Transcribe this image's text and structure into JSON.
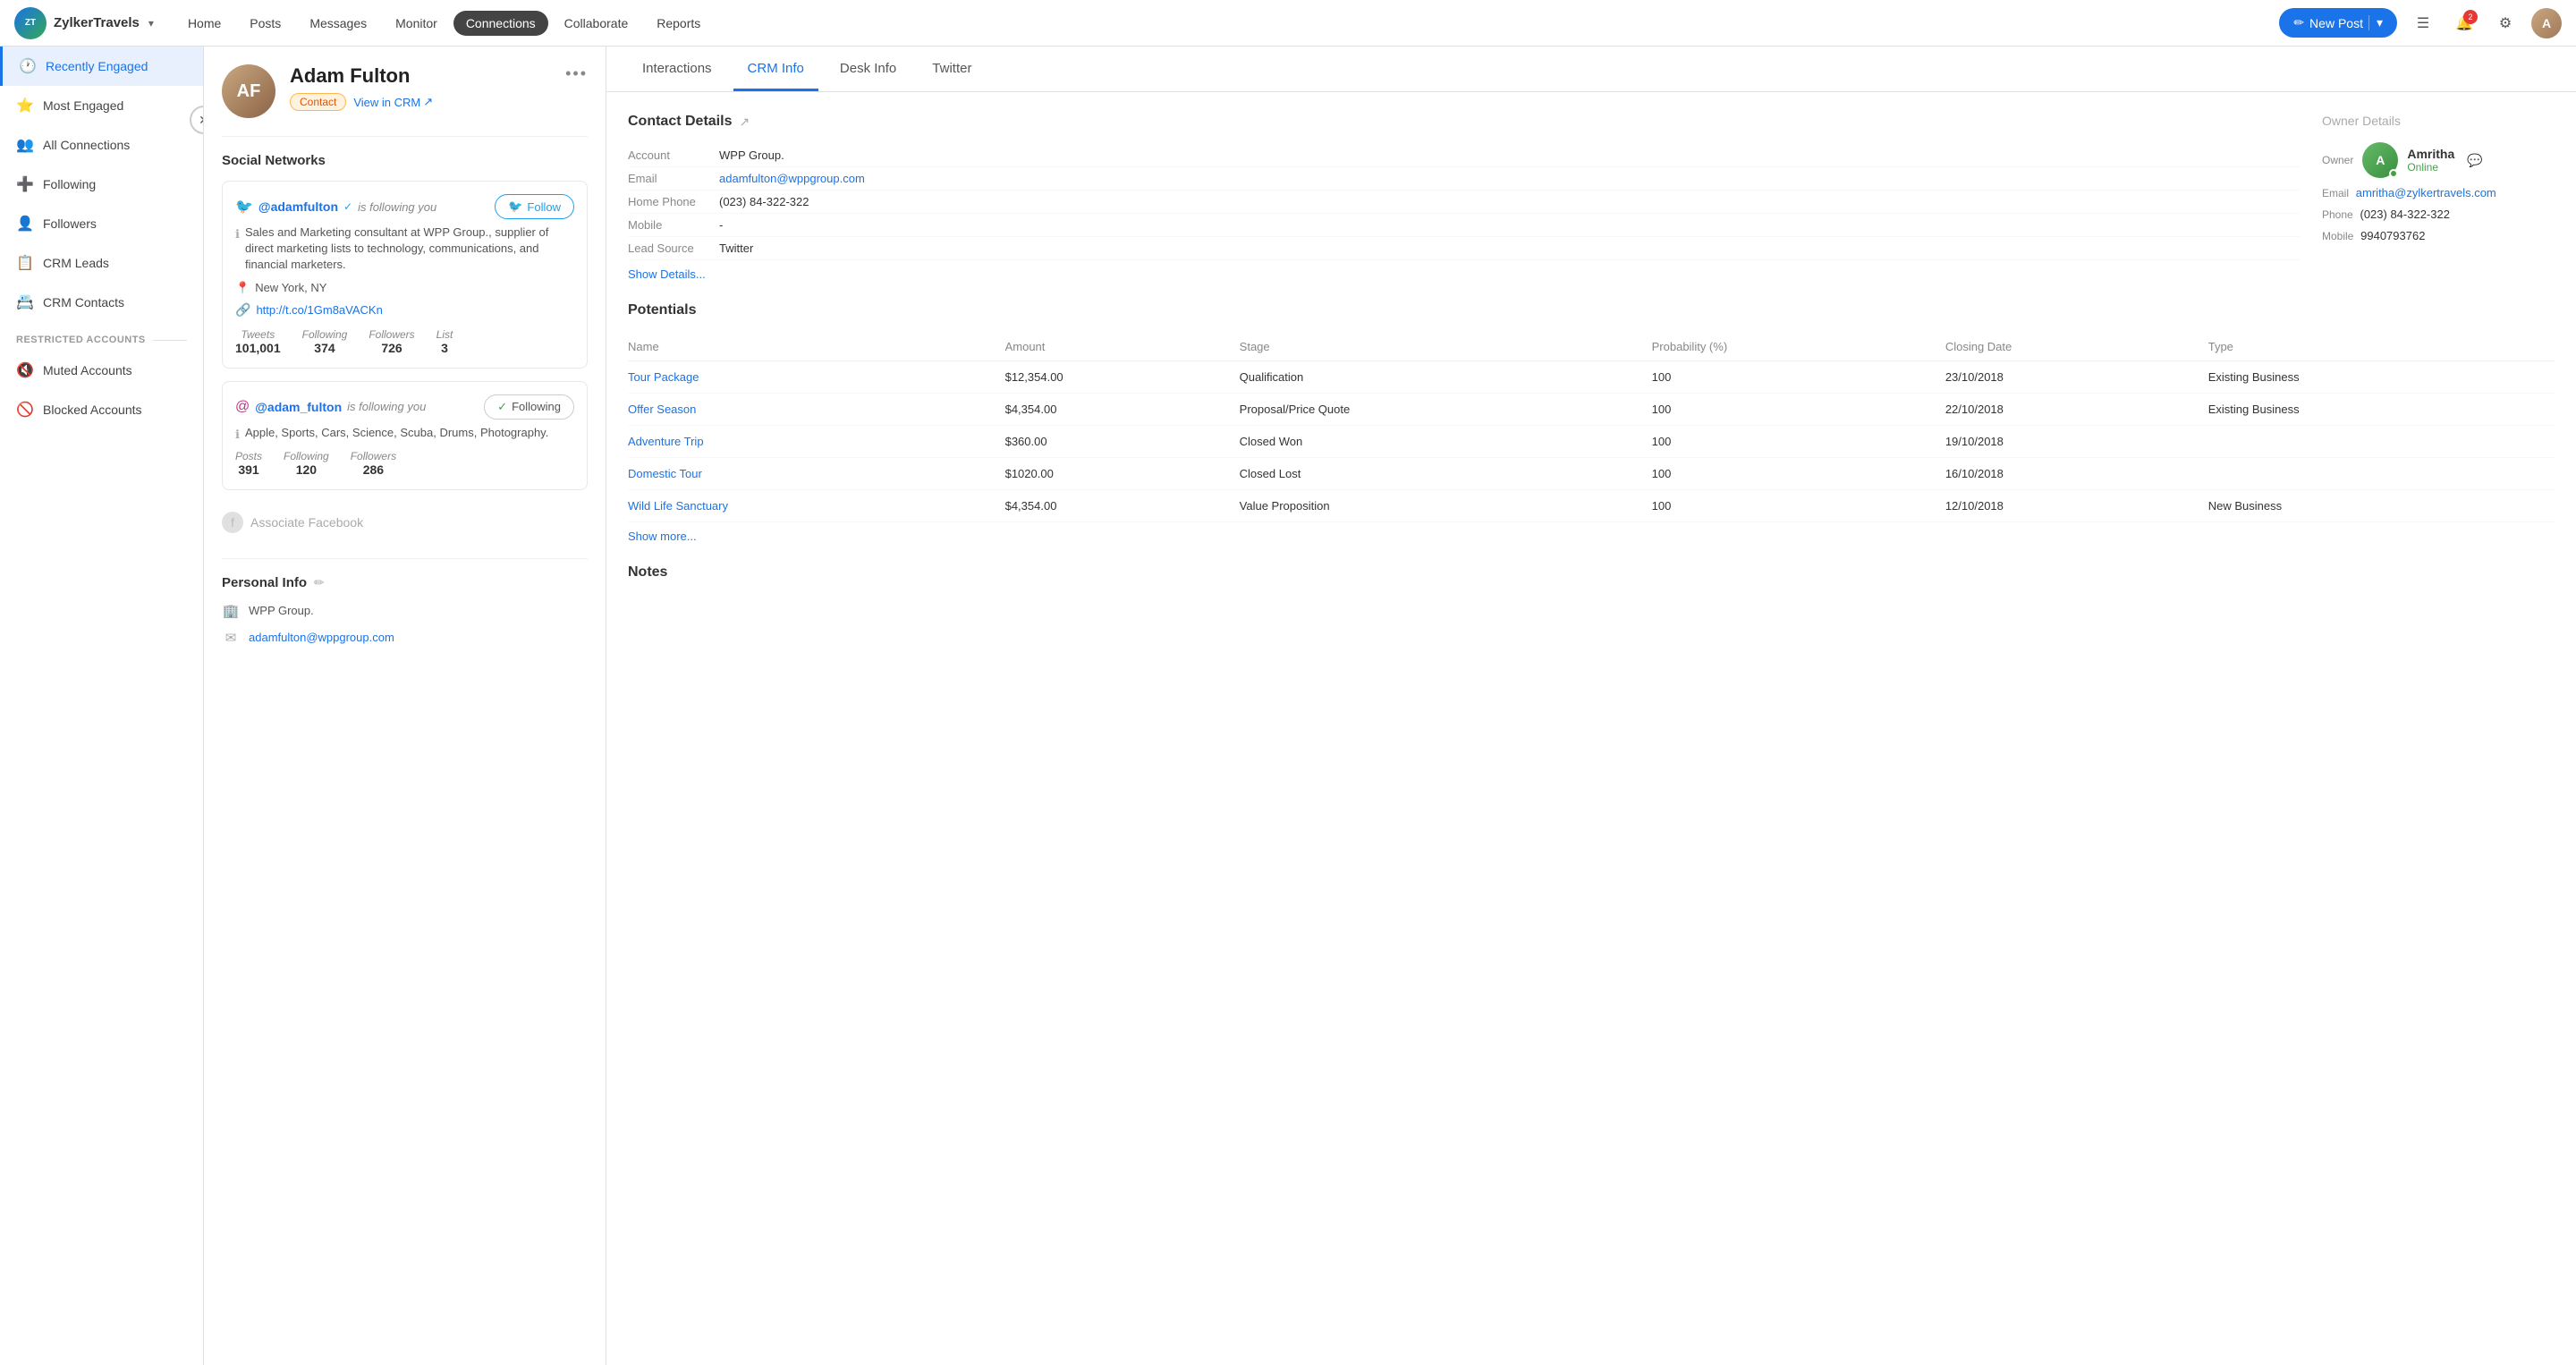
{
  "brand": {
    "logo_initials": "ZT",
    "name": "ZylkerTravels",
    "caret": "▾"
  },
  "nav": {
    "links": [
      {
        "label": "Home",
        "active": false
      },
      {
        "label": "Posts",
        "active": false
      },
      {
        "label": "Messages",
        "active": false
      },
      {
        "label": "Monitor",
        "active": false
      },
      {
        "label": "Connections",
        "active": true
      },
      {
        "label": "Collaborate",
        "active": false
      },
      {
        "label": "Reports",
        "active": false
      }
    ],
    "new_post_label": "New Post",
    "notification_count": "2"
  },
  "sidebar": {
    "items": [
      {
        "id": "recently-engaged",
        "label": "Recently Engaged",
        "icon": "🕐",
        "active": true
      },
      {
        "id": "most-engaged",
        "label": "Most Engaged",
        "icon": "⭐",
        "active": false
      },
      {
        "id": "all-connections",
        "label": "All Connections",
        "icon": "👥",
        "active": false
      },
      {
        "id": "following",
        "label": "Following",
        "icon": "➕",
        "active": false
      },
      {
        "id": "followers",
        "label": "Followers",
        "icon": "👤",
        "active": false
      },
      {
        "id": "crm-leads",
        "label": "CRM Leads",
        "icon": "📋",
        "active": false
      },
      {
        "id": "crm-contacts",
        "label": "CRM Contacts",
        "icon": "📇",
        "active": false
      }
    ],
    "restricted_section": "RESTRICTED ACCOUNTS",
    "restricted_items": [
      {
        "id": "muted-accounts",
        "label": "Muted Accounts",
        "icon": "🔇",
        "active": false
      },
      {
        "id": "blocked-accounts",
        "label": "Blocked Accounts",
        "icon": "🚫",
        "active": false
      }
    ]
  },
  "profile": {
    "name": "Adam Fulton",
    "avatar_initials": "AF",
    "tag": "Contact",
    "view_crm_label": "View in CRM",
    "more_icon": "•••",
    "social_networks_title": "Social Networks",
    "twitter": {
      "handle": "@adamfulton",
      "verified": true,
      "following_you_text": "is following you",
      "follow_label": "Follow",
      "bio": "Sales and Marketing consultant at WPP Group., supplier of direct marketing lists to technology, communications, and financial marketers.",
      "location": "New York, NY",
      "link": "http://t.co/1Gm8aVACKn",
      "stats": [
        {
          "label": "Tweets",
          "value": "101,001"
        },
        {
          "label": "Following",
          "value": "374"
        },
        {
          "label": "Followers",
          "value": "726"
        },
        {
          "label": "List",
          "value": "3"
        }
      ]
    },
    "instagram": {
      "handle": "@adam_fulton",
      "following_you_text": "is following you",
      "following_label": "Following",
      "bio": "Apple, Sports, Cars, Science, Scuba, Drums, Photography.",
      "stats": [
        {
          "label": "Posts",
          "value": "391"
        },
        {
          "label": "Following",
          "value": "120"
        },
        {
          "label": "Followers",
          "value": "286"
        }
      ]
    },
    "associate_facebook_label": "Associate Facebook",
    "personal_info_title": "Personal Info",
    "company": "WPP Group.",
    "email": "adamfulton@wppgroup.com"
  },
  "tabs": [
    {
      "label": "Interactions",
      "active": false
    },
    {
      "label": "CRM Info",
      "active": true
    },
    {
      "label": "Desk Info",
      "active": false
    },
    {
      "label": "Twitter",
      "active": false
    }
  ],
  "crm_info": {
    "contact_details_title": "Contact Details",
    "fields": [
      {
        "label": "Account",
        "value": "WPP Group.",
        "link": false
      },
      {
        "label": "Email",
        "value": "adamfulton@wppgroup.com",
        "link": true
      },
      {
        "label": "Home Phone",
        "value": "(023) 84-322-322",
        "link": false
      },
      {
        "label": "Mobile",
        "value": "-",
        "link": false
      },
      {
        "label": "Lead Source",
        "value": "Twitter",
        "link": false
      }
    ],
    "show_details_label": "Show Details...",
    "owner_details_title": "Owner Details",
    "owner": {
      "label": "Owner",
      "name": "Amritha",
      "status": "Online",
      "email_label": "Email",
      "email": "amritha@zylkertravels.com",
      "phone_label": "Phone",
      "phone": "(023) 84-322-322",
      "mobile_label": "Mobile",
      "mobile": "9940793762"
    },
    "potentials_title": "Potentials",
    "potentials_headers": [
      "Name",
      "Amount",
      "Stage",
      "Probability (%)",
      "Closing Date",
      "Type"
    ],
    "potentials_rows": [
      {
        "name": "Tour Package",
        "amount": "$12,354.00",
        "stage": "Qualification",
        "probability": "100",
        "closing_date": "23/10/2018",
        "type": "Existing Business"
      },
      {
        "name": "Offer Season",
        "amount": "$4,354.00",
        "stage": "Proposal/Price Quote",
        "probability": "100",
        "closing_date": "22/10/2018",
        "type": "Existing Business"
      },
      {
        "name": "Adventure Trip",
        "amount": "$360.00",
        "stage": "Closed Won",
        "probability": "100",
        "closing_date": "19/10/2018",
        "type": ""
      },
      {
        "name": "Domestic Tour",
        "amount": "$1020.00",
        "stage": "Closed Lost",
        "probability": "100",
        "closing_date": "16/10/2018",
        "type": ""
      },
      {
        "name": "Wild Life Sanctuary",
        "amount": "$4,354.00",
        "stage": "Value Proposition",
        "probability": "100",
        "closing_date": "12/10/2018",
        "type": "New Business"
      }
    ],
    "show_more_label": "Show more...",
    "notes_title": "Notes"
  }
}
